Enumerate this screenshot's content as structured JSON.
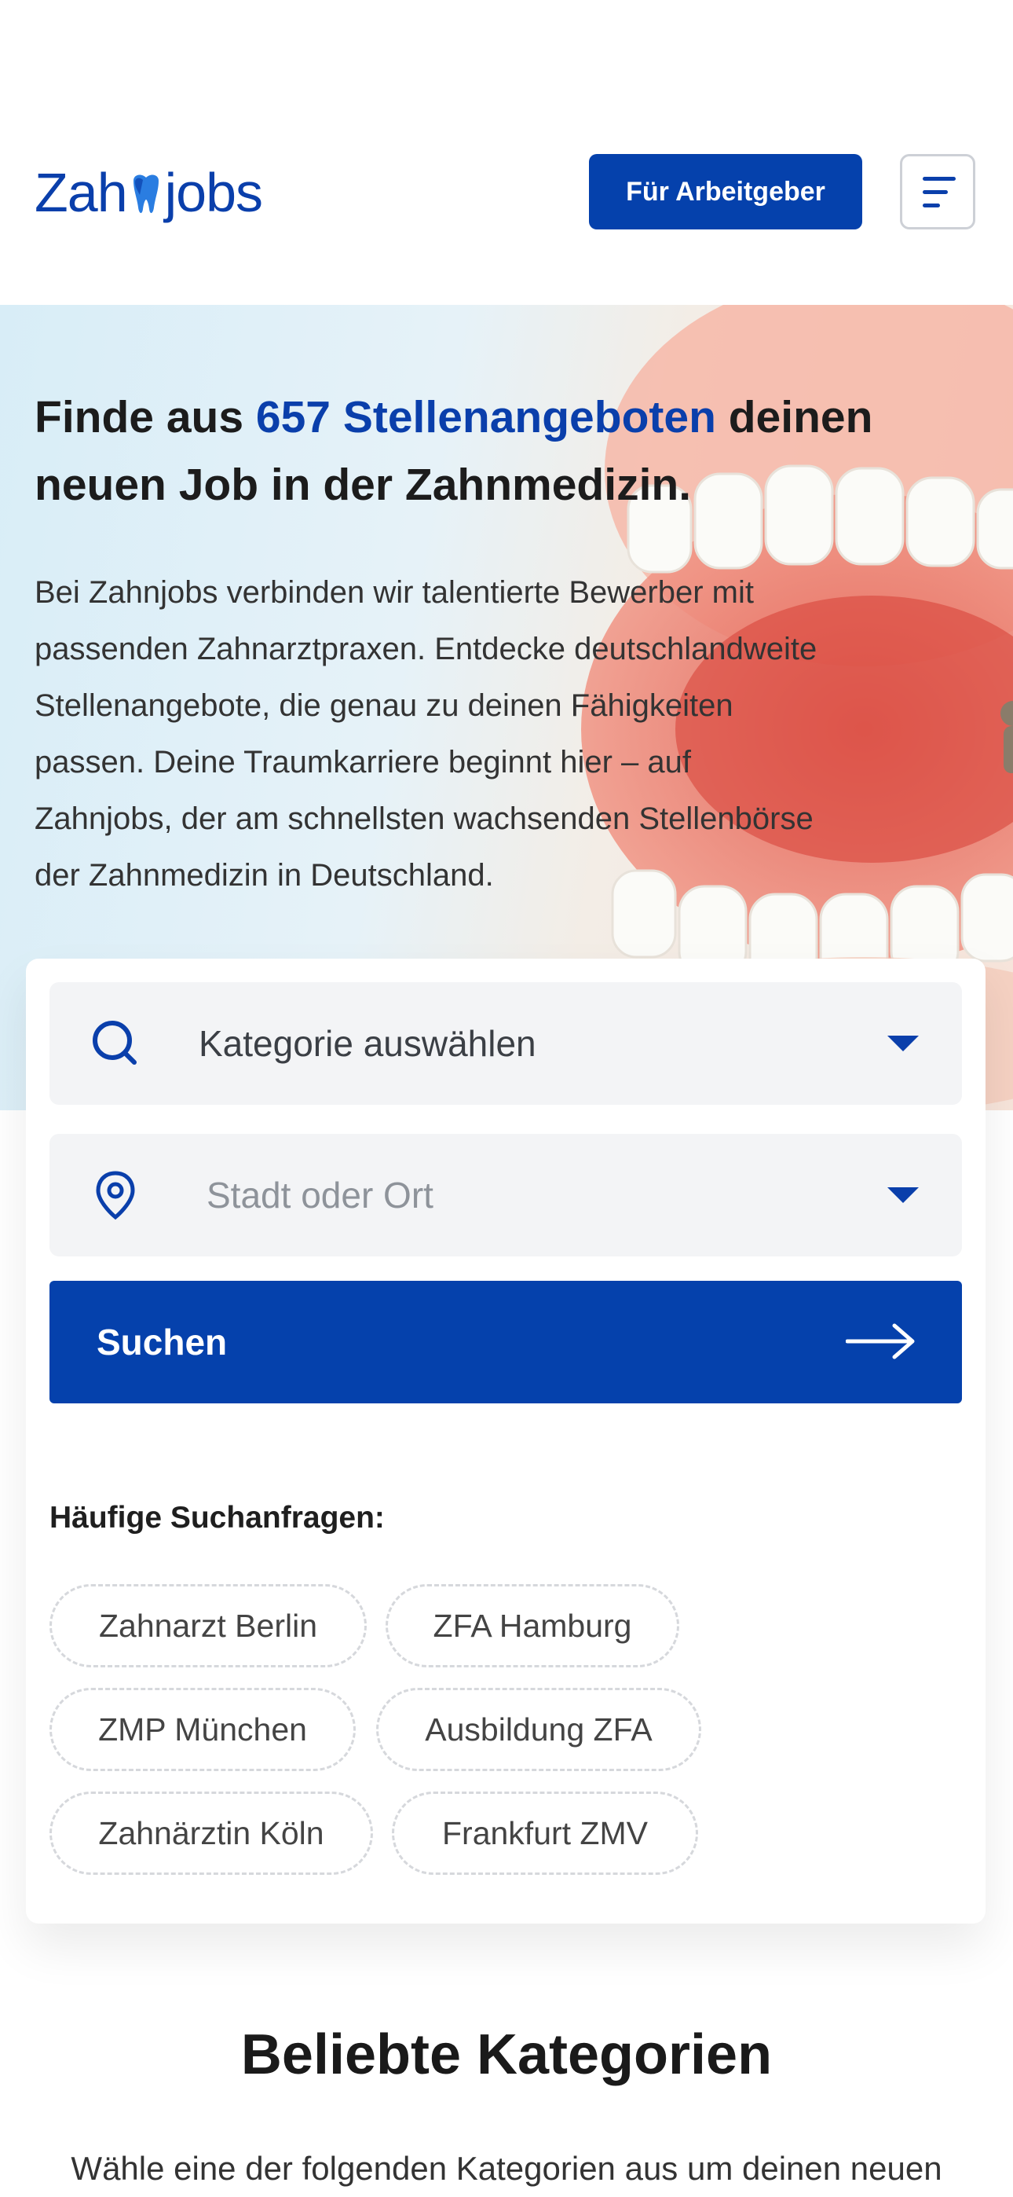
{
  "header": {
    "logo_before": "Zah",
    "logo_after": "jobs",
    "employer_button": "Für Arbeitgeber",
    "menu_icon": "hamburger-menu-icon"
  },
  "hero": {
    "title_part1": "Finde aus ",
    "title_accent": "657 Stellenangeboten",
    "title_part2": " deinen neuen Job in der Zahnmedizin.",
    "text": "Bei Zahnjobs verbinden wir talentierte Bewerber mit passenden Zahnarztpraxen. Entdecke deutschlandweite Stellenangebote, die genau zu deinen Fähigkeiten passen. Deine Traumkarriere beginnt hier – auf Zahnjobs, der am schnellsten wachsenden Stellenbörse der Zahnmedizin in Deutschland."
  },
  "search": {
    "category_value": "Kategorie auswählen",
    "category_icon": "search-icon",
    "location_placeholder": "Stadt oder Ort",
    "location_icon": "location-pin-icon",
    "button_label": "Suchen",
    "button_icon": "arrow-right-icon",
    "frequent_title": "Häufige Suchanfragen:",
    "chips": [
      "Zahnarzt Berlin",
      "ZFA Hamburg",
      "ZMP München",
      "Ausbildung ZFA",
      "Zahnärztin Köln",
      "Frankfurt ZMV"
    ]
  },
  "categories": {
    "title": "Beliebte Kategorien",
    "subtitle": "Wähle eine der folgenden Kategorien aus um deinen neuen"
  },
  "colors": {
    "brand": "#0541ac",
    "accent_text": "#0a3fab"
  }
}
